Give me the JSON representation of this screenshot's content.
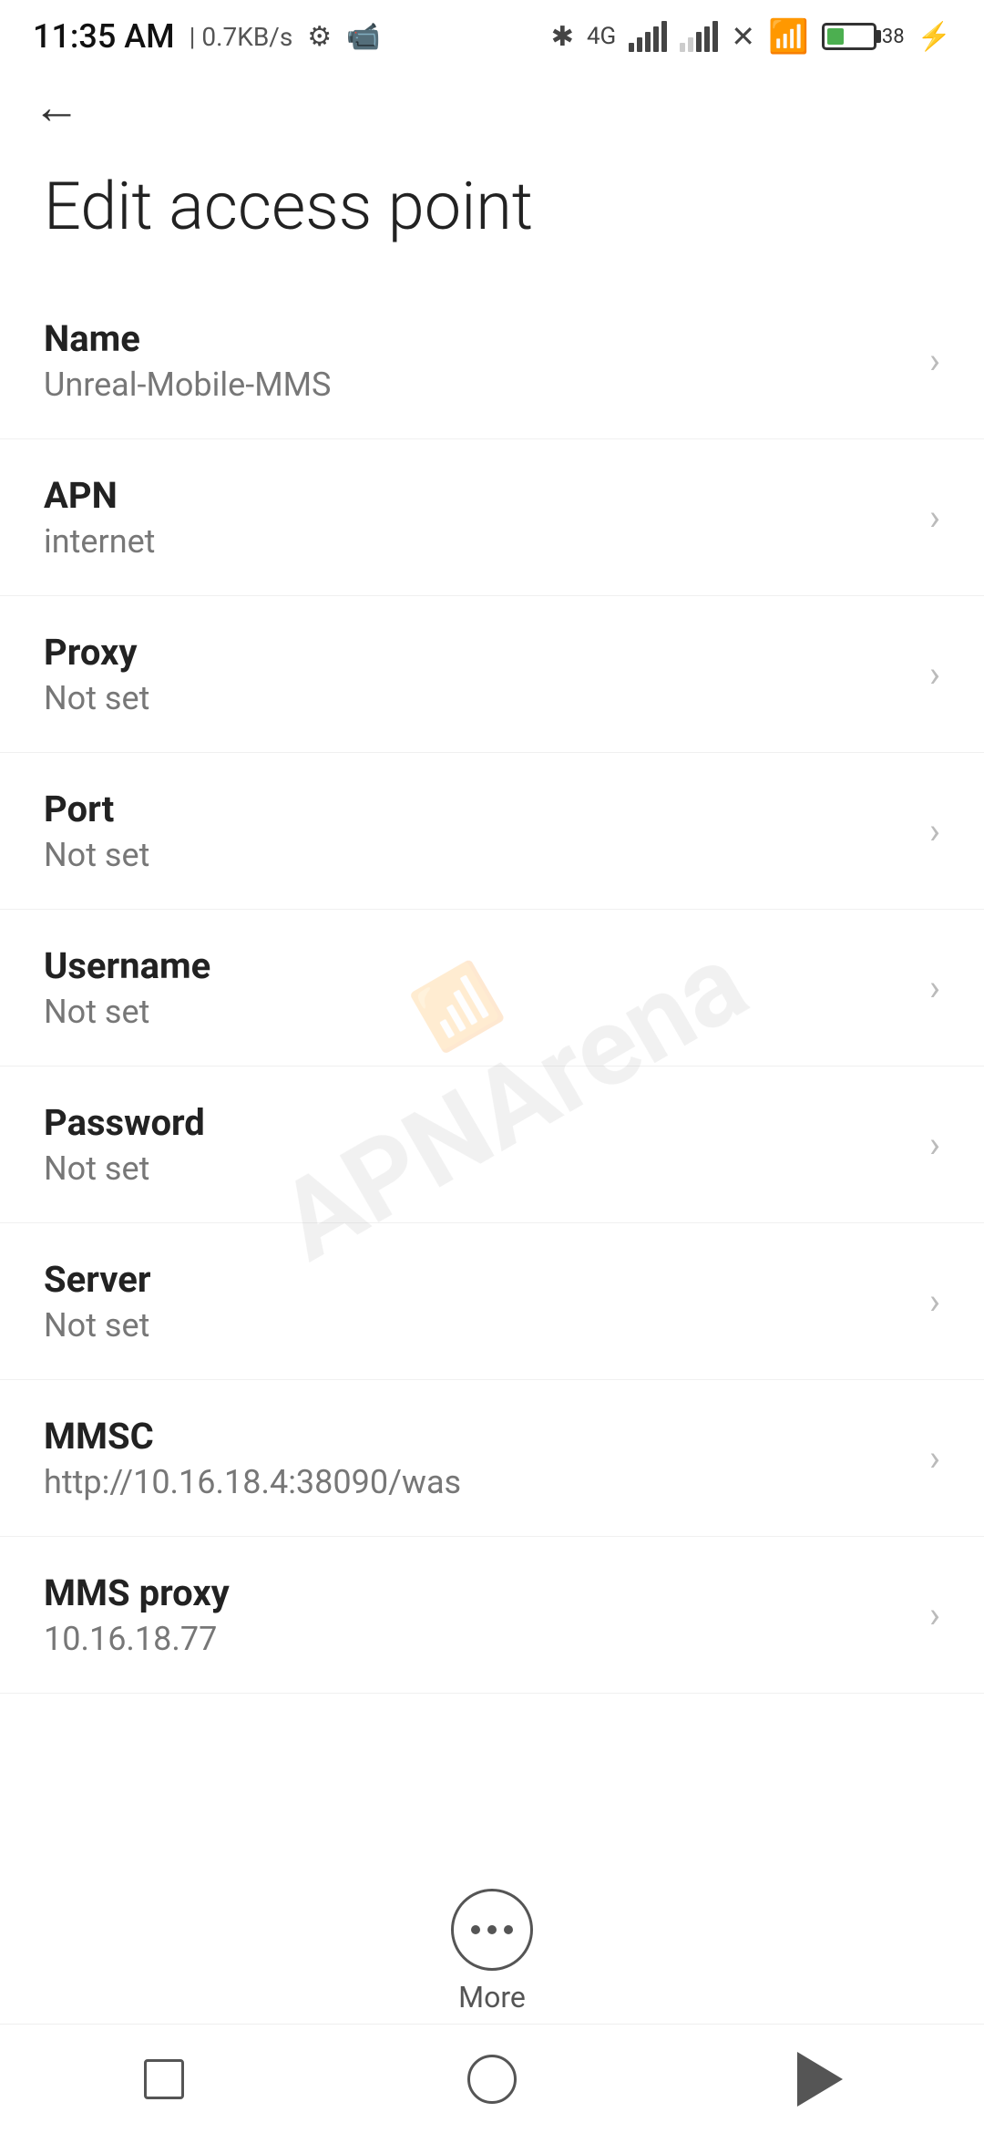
{
  "statusBar": {
    "time": "11:35 AM",
    "speed": "0.7KB/s"
  },
  "nav": {
    "backLabel": "←"
  },
  "pageTitle": "Edit access point",
  "settings": [
    {
      "id": "name",
      "label": "Name",
      "value": "Unreal-Mobile-MMS"
    },
    {
      "id": "apn",
      "label": "APN",
      "value": "internet"
    },
    {
      "id": "proxy",
      "label": "Proxy",
      "value": "Not set"
    },
    {
      "id": "port",
      "label": "Port",
      "value": "Not set"
    },
    {
      "id": "username",
      "label": "Username",
      "value": "Not set"
    },
    {
      "id": "password",
      "label": "Password",
      "value": "Not set"
    },
    {
      "id": "server",
      "label": "Server",
      "value": "Not set"
    },
    {
      "id": "mmsc",
      "label": "MMSC",
      "value": "http://10.16.18.4:38090/was"
    },
    {
      "id": "mms-proxy",
      "label": "MMS proxy",
      "value": "10.16.18.77"
    }
  ],
  "more": {
    "label": "More"
  },
  "watermark": {
    "text": "APNArena"
  }
}
